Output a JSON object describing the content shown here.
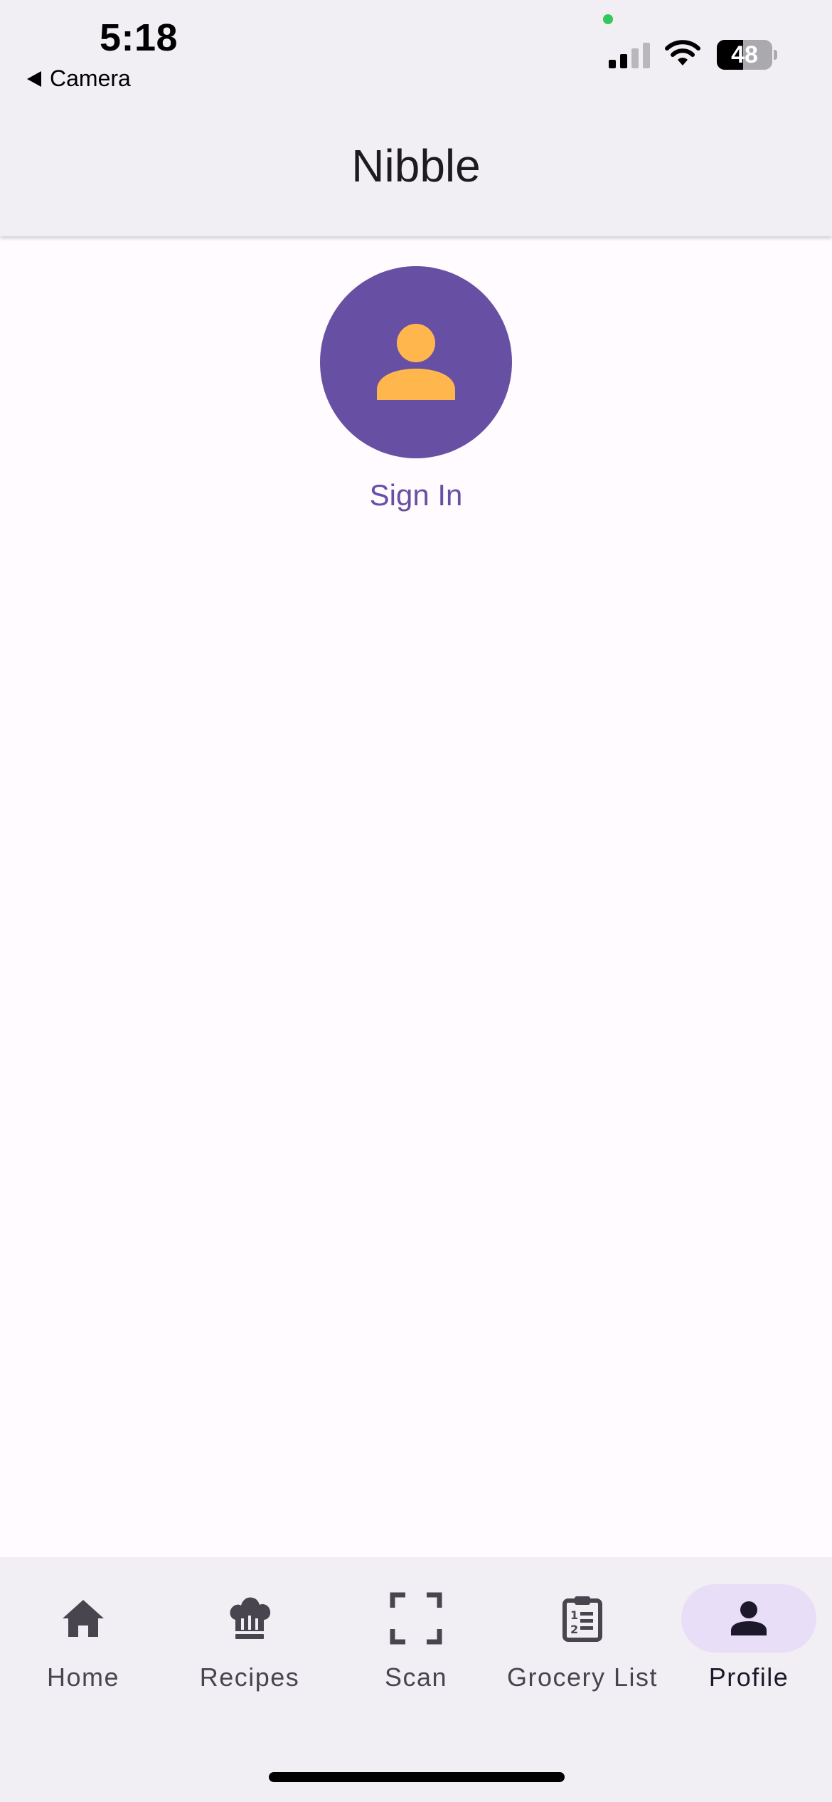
{
  "status_bar": {
    "time": "5:18",
    "back_app": "Camera",
    "battery_level": "48"
  },
  "header": {
    "title": "Nibble"
  },
  "profile": {
    "avatar_icon": "person-icon",
    "sign_in_label": "Sign In"
  },
  "bottom_nav": {
    "items": [
      {
        "label": "Home",
        "icon": "home-icon",
        "active": false
      },
      {
        "label": "Recipes",
        "icon": "chef-hat-icon",
        "active": false
      },
      {
        "label": "Scan",
        "icon": "scan-frame-icon",
        "active": false
      },
      {
        "label": "Grocery List",
        "icon": "clipboard-list-icon",
        "active": false
      },
      {
        "label": "Profile",
        "icon": "person-icon",
        "active": true
      }
    ]
  },
  "colors": {
    "primary": "#6750a4",
    "avatar_person": "#ffb74d",
    "nav_active_indicator": "#e8def8",
    "surface": "#f2eff4",
    "background": "#fffbfe"
  }
}
